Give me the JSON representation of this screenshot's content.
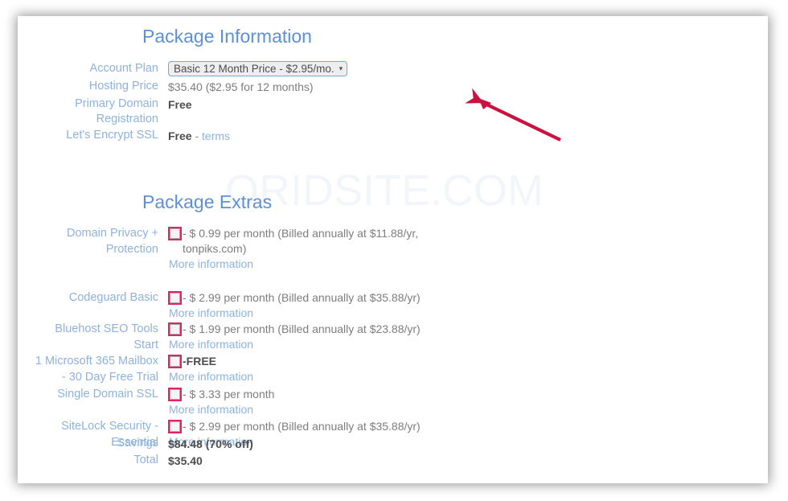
{
  "watermark": "ORIDSITE.COM",
  "colors": {
    "heading_blue": "#5d90d6",
    "label_blue": "#8db2dd",
    "value_gray": "#7d7d7d",
    "highlight_pink": "#e0245e",
    "arrow_crimson": "#cc1040"
  },
  "package_information": {
    "title": "Package Information",
    "rows": [
      {
        "label": "Account Plan",
        "type": "select",
        "selected": "Basic 12 Month Price - $2.95/mo.",
        "caret": "chevron-down-icon"
      },
      {
        "label": "Hosting Price",
        "type": "text",
        "value": "$35.40  ($2.95 for 12 months)"
      },
      {
        "label": "Primary Domain\nRegistration",
        "type": "bold",
        "value": "Free"
      },
      {
        "label": "Let's Encrypt SSL",
        "type": "bold_with_link",
        "value": "Free",
        "separator": " - ",
        "link": "terms"
      }
    ]
  },
  "package_extras": {
    "title": "Package Extras",
    "items": [
      {
        "label": "Domain Privacy +\nProtection",
        "checked": false,
        "price": "- $ 0.99 per month (Billed annually at $11.88/yr, tonpiks.com)",
        "more": "More information"
      },
      {
        "label": "Codeguard Basic",
        "checked": false,
        "price": "- $ 2.99 per month (Billed annually at $35.88/yr)",
        "more": "More information"
      },
      {
        "label": "Bluehost SEO Tools\nStart",
        "checked": false,
        "price": "- $ 1.99 per month (Billed annually at $23.88/yr)",
        "more": "More information"
      },
      {
        "label": "1 Microsoft 365 Mailbox\n- 30 Day Free Trial",
        "checked": false,
        "price": "-FREE",
        "price_bold": true,
        "more": "More information"
      },
      {
        "label": "Single Domain SSL",
        "checked": false,
        "price": "- $ 3.33 per month",
        "more": "More information"
      },
      {
        "label": "SiteLock Security -\nEssential",
        "checked": false,
        "price": "- $ 2.99 per month (Billed annually at $35.88/yr)",
        "more": "More information"
      }
    ],
    "summary": [
      {
        "label": "Savings",
        "value": "$84.48 (70% off)"
      },
      {
        "label": "Total",
        "value": "$35.40"
      }
    ]
  }
}
